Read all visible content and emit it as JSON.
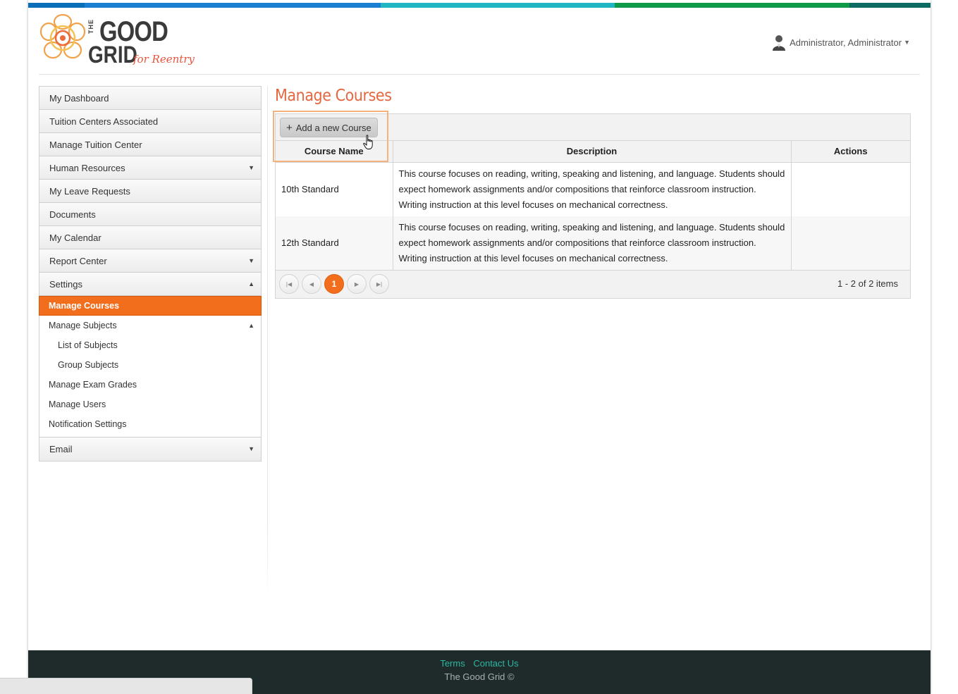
{
  "brand": {
    "logo_the": "THE",
    "logo_good": "GOOD",
    "logo_grid": "GRID",
    "logo_tagline": "for Reentry",
    "stripe_colors": [
      "#0b6fb7",
      "#1a8fd6",
      "#20b5c3",
      "#0f9a4a",
      "#0e6b63"
    ],
    "accent_color": "#f26e1d",
    "title_color": "#e5673f"
  },
  "header": {
    "user_name": "Administrator, Administrator",
    "user_icon": "user-avatar-icon",
    "caret_icon": "caret-down-icon"
  },
  "sidebar": {
    "items": [
      {
        "label": "My Dashboard",
        "has_arrow": false
      },
      {
        "label": "Tuition Centers Associated",
        "has_arrow": false
      },
      {
        "label": "Manage Tuition Center",
        "has_arrow": false
      },
      {
        "label": "Human Resources",
        "has_arrow": true,
        "arrow": "▼"
      },
      {
        "label": "My Leave Requests",
        "has_arrow": false
      },
      {
        "label": "Documents",
        "has_arrow": false
      },
      {
        "label": "My Calendar",
        "has_arrow": false
      },
      {
        "label": "Report Center",
        "has_arrow": true,
        "arrow": "▼"
      },
      {
        "label": "Settings",
        "has_arrow": true,
        "arrow": "▲"
      }
    ],
    "settings_sub": {
      "manage_courses": "Manage Courses",
      "manage_subjects": "Manage Subjects",
      "manage_subjects_arrow": "▲",
      "list_of_subjects": "List of Subjects",
      "group_subjects": "Group Subjects",
      "manage_exam_grades": "Manage Exam Grades",
      "manage_users": "Manage Users",
      "notification_settings": "Notification Settings"
    },
    "email": {
      "label": "Email",
      "arrow": "▼"
    }
  },
  "main": {
    "title": "Manage Courses",
    "add_button": {
      "label": "Add a new Course",
      "icon": "plus-icon"
    },
    "columns": [
      "Course Name",
      "Description",
      "Actions"
    ],
    "rows": [
      {
        "course_name": "10th Standard",
        "description": "This course focuses on reading, writing, speaking and listening, and language. Students should expect homework assignments and/or compositions that reinforce classroom instruction. Writing instruction at this level focuses on mechanical correctness.",
        "actions": ""
      },
      {
        "course_name": "12th Standard",
        "description": "This course focuses on reading, writing, speaking and listening, and language. Students should expect homework assignments and/or compositions that reinforce classroom instruction. Writing instruction at this level focuses on mechanical correctness.",
        "actions": ""
      }
    ],
    "pager": {
      "first": "⏮",
      "prev": "◀",
      "current_page": "1",
      "next": "▶",
      "last": "⏭",
      "info": "1 - 2 of 2 items"
    }
  },
  "footer": {
    "terms": "Terms",
    "contact": "Contact Us",
    "copyright": "The Good Grid ©"
  }
}
